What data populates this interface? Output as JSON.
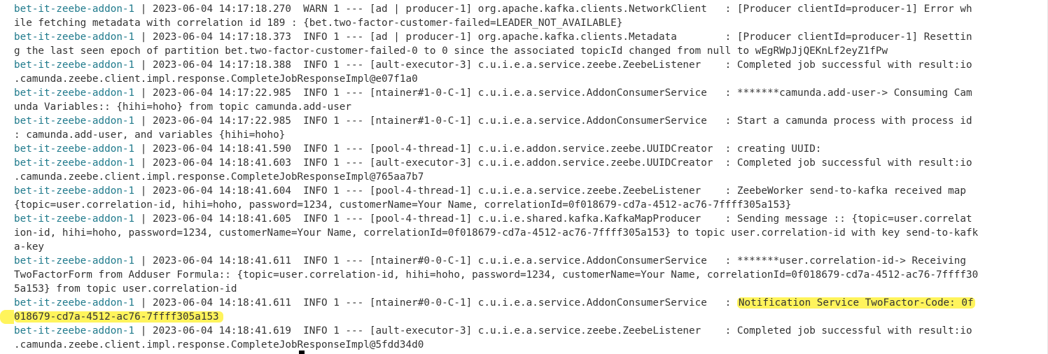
{
  "logs": [
    {
      "svc": "bet-it-zeebe-addon-1",
      "rest": " | 2023-06-04 14:17:18.270  WARN 1 --- [ad | producer-1] org.apache.kafka.clients.NetworkClient   : [Producer clientId=producer-1] Error wh",
      "cont": "ile fetching metadata with correlation id 189 : {bet.two-factor-customer-failed=LEADER_NOT_AVAILABLE}"
    },
    {
      "svc": "bet-it-zeebe-addon-1",
      "rest": " | 2023-06-04 14:17:18.373  INFO 1 --- [ad | producer-1] org.apache.kafka.clients.Metadata        : [Producer clientId=producer-1] Resettin",
      "cont": "g the last seen epoch of partition bet.two-factor-customer-failed-0 to 0 since the associated topicId changed from null to wEgRWpJjQEKnLf2eyZ1fPw"
    },
    {
      "svc": "bet-it-zeebe-addon-1",
      "rest": " | 2023-06-04 14:17:18.388  INFO 1 --- [ault-executor-3] c.u.i.e.a.service.zeebe.ZeebeListener    : Completed job successful with result:io",
      "cont": ".camunda.zeebe.client.impl.response.CompleteJobResponseImpl@e07f1a0"
    },
    {
      "svc": "bet-it-zeebe-addon-1",
      "rest": " | 2023-06-04 14:17:22.985  INFO 1 --- [ntainer#1-0-C-1] c.u.i.e.a.service.AddonConsumerService   : *******camunda.add-user-> Consuming Cam",
      "cont": "unda Variables:: {hihi=hoho} from topic camunda.add-user"
    },
    {
      "svc": "bet-it-zeebe-addon-1",
      "rest": " | 2023-06-04 14:17:22.985  INFO 1 --- [ntainer#1-0-C-1] c.u.i.e.a.service.AddonConsumerService   : Start a camunda process with process id",
      "cont": ": camunda.add-user, and variables {hihi=hoho}"
    },
    {
      "svc": "bet-it-zeebe-addon-1",
      "rest": " | 2023-06-04 14:18:41.590  INFO 1 --- [pool-4-thread-1] c.u.i.e.addon.service.zeebe.UUIDCreator  : creating UUID:",
      "cont": ""
    },
    {
      "svc": "bet-it-zeebe-addon-1",
      "rest": " | 2023-06-04 14:18:41.603  INFO 1 --- [ault-executor-3] c.u.i.e.addon.service.zeebe.UUIDCreator  : Completed job successful with result:io",
      "cont": ".camunda.zeebe.client.impl.response.CompleteJobResponseImpl@765aa7b7"
    },
    {
      "svc": "bet-it-zeebe-addon-1",
      "rest": " | 2023-06-04 14:18:41.604  INFO 1 --- [pool-4-thread-1] c.u.i.e.a.service.zeebe.ZeebeListener    : ZeebeWorker send-to-kafka received map",
      "cont": "{topic=user.correlation-id, hihi=hoho, password=1234, customerName=Your Name, correlationId=0f018679-cd7a-4512-ac76-7ffff305a153}"
    },
    {
      "svc": "bet-it-zeebe-addon-1",
      "rest": " | 2023-06-04 14:18:41.605  INFO 1 --- [pool-4-thread-1] c.u.i.e.shared.kafka.KafkaMapProducer    : Sending message :: {topic=user.correlat",
      "cont": "ion-id, hihi=hoho, password=1234, customerName=Your Name, correlationId=0f018679-cd7a-4512-ac76-7ffff305a153} to topic user.correlation-id with key send-to-kafk",
      "cont2": "a-key"
    },
    {
      "svc": "bet-it-zeebe-addon-1",
      "rest": " | 2023-06-04 14:18:41.611  INFO 1 --- [ntainer#0-0-C-1] c.u.i.e.a.service.AddonConsumerService   : *******user.correlation-id-> Receiving ",
      "cont": "TwoFactorForm from Adduser Formula:: {topic=user.correlation-id, hihi=hoho, password=1234, customerName=Your Name, correlationId=0f018679-cd7a-4512-ac76-7ffff30",
      "cont2": "5a153} from topic user.correlation-id"
    },
    {
      "svc": "bet-it-zeebe-addon-1",
      "rest": " | 2023-06-04 14:18:41.611  INFO 1 --- [ntainer#0-0-C-1] c.u.i.e.a.service.AddonConsumerService   : ",
      "hl": "Notification Service TwoFactor-Code: 0f",
      "cont_hl": "018679-cd7a-4512-ac76-7ffff305a153"
    },
    {
      "svc": "bet-it-zeebe-addon-1",
      "rest": " | 2023-06-04 14:18:41.619  INFO 1 --- [ault-executor-3] c.u.i.e.a.service.zeebe.ZeebeListener    : Completed job successful with result:io",
      "cont": ".camunda.zeebe.client.impl.response.CompleteJobResponseImpl@5fdd34d0"
    }
  ]
}
